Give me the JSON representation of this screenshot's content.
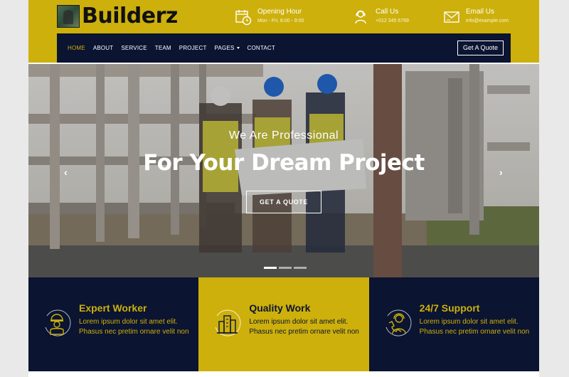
{
  "brand": {
    "name": "Builderz"
  },
  "contact": [
    {
      "title": "Opening Hour",
      "sub": "Mon - Fri, 8:00 - 9:00",
      "icon": "calendar-clock-icon"
    },
    {
      "title": "Call Us",
      "sub": "+012 345 6789",
      "icon": "phone-support-icon"
    },
    {
      "title": "Email Us",
      "sub": "info@example.com",
      "icon": "envelope-icon"
    }
  ],
  "nav": {
    "items": [
      "HOME",
      "ABOUT",
      "SERVICE",
      "TEAM",
      "PROJECT",
      "PAGES",
      "CONTACT"
    ],
    "active": "HOME",
    "quote": "Get A Quote"
  },
  "hero": {
    "subtitle": "We Are Professional",
    "title": "For Your Dream Project",
    "button": "GET A QUOTE",
    "prev": "‹",
    "next": "›",
    "slides": 3,
    "active_slide": 1
  },
  "features": [
    {
      "title": "Expert Worker",
      "text": "Lorem ipsum dolor sit amet elit. Phasus nec pretim ornare velit non",
      "icon": "worker-icon",
      "theme": "dark"
    },
    {
      "title": "Quality Work",
      "text": "Lorem ipsum dolor sit amet elit. Phasus nec pretim ornare velit non",
      "icon": "building-icon",
      "theme": "gold"
    },
    {
      "title": "24/7 Support",
      "text": "Lorem ipsum dolor sit amet elit. Phasus nec pretim ornare velit non",
      "icon": "support-icon",
      "theme": "dark"
    }
  ],
  "colors": {
    "gold": "#cdb00b",
    "navy": "#0b1431",
    "white": "#ffffff"
  }
}
